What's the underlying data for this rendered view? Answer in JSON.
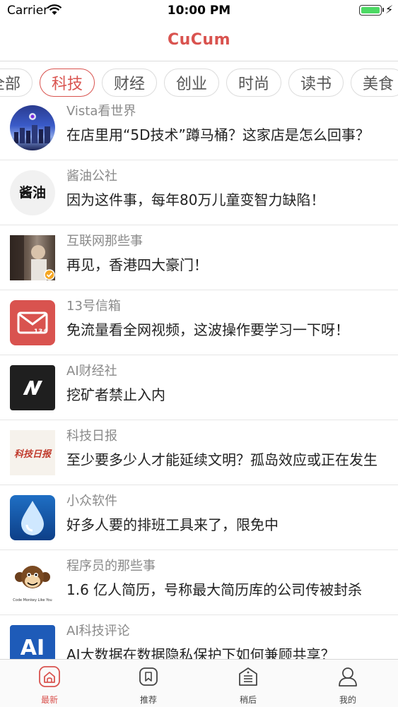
{
  "status_bar": {
    "carrier": "Carrier",
    "time": "10:00 PM"
  },
  "header": {
    "title": "CuCum"
  },
  "categories": [
    {
      "label": "全部",
      "active": false
    },
    {
      "label": "科技",
      "active": true
    },
    {
      "label": "财经",
      "active": false
    },
    {
      "label": "创业",
      "active": false
    },
    {
      "label": "时尚",
      "active": false
    },
    {
      "label": "读书",
      "active": false
    },
    {
      "label": "美食",
      "active": false
    }
  ],
  "articles": [
    {
      "source": "Vista看世界",
      "headline": "在店里用“5D技术”蹲马桶？这家店是怎么回事？",
      "avatar": "vista-avatar"
    },
    {
      "source": "酱油公社",
      "headline": "因为这件事，每年80万儿童变智力缺陷！",
      "avatar": "jiangyou-avatar",
      "avatar_text": "酱油"
    },
    {
      "source": "互联网那些事",
      "headline": "再见，香港四大豪门！",
      "avatar": "photo-avatar"
    },
    {
      "source": "13号信箱",
      "headline": "免流量看全网视频，这波操作要学习一下呀！",
      "avatar": "mailbox-avatar",
      "avatar_text": "13#"
    },
    {
      "source": "AI财经社",
      "headline": "挖矿者禁止入内",
      "avatar": "ai-finance-avatar"
    },
    {
      "source": "科技日报",
      "headline": "至少要多少人才能延续文明？孤岛效应或正在发生",
      "avatar": "keji-ribao-avatar",
      "avatar_text": "科技日报"
    },
    {
      "source": "小众软件",
      "headline": "好多人要的排班工具来了，限免中",
      "avatar": "drop-avatar"
    },
    {
      "source": "程序员的那些事",
      "headline": "1.6 亿人简历，号称最大简历库的公司传被封杀",
      "avatar": "monkey-avatar",
      "avatar_text": "Code Monkey Like You"
    },
    {
      "source": "AI科技评论",
      "headline": "AI大数据在数据隐私保护下如何兼顾共享？",
      "avatar": "ai-review-avatar",
      "avatar_text": "AI"
    }
  ],
  "tab_bar": [
    {
      "label": "最新",
      "icon": "home-icon",
      "active": true
    },
    {
      "label": "推荐",
      "icon": "bookmark-icon",
      "active": false
    },
    {
      "label": "稍后",
      "icon": "read-later-icon",
      "active": false
    },
    {
      "label": "我的",
      "icon": "user-icon",
      "active": false
    }
  ],
  "colors": {
    "accent": "#d9534f",
    "battery": "#4cd964"
  }
}
